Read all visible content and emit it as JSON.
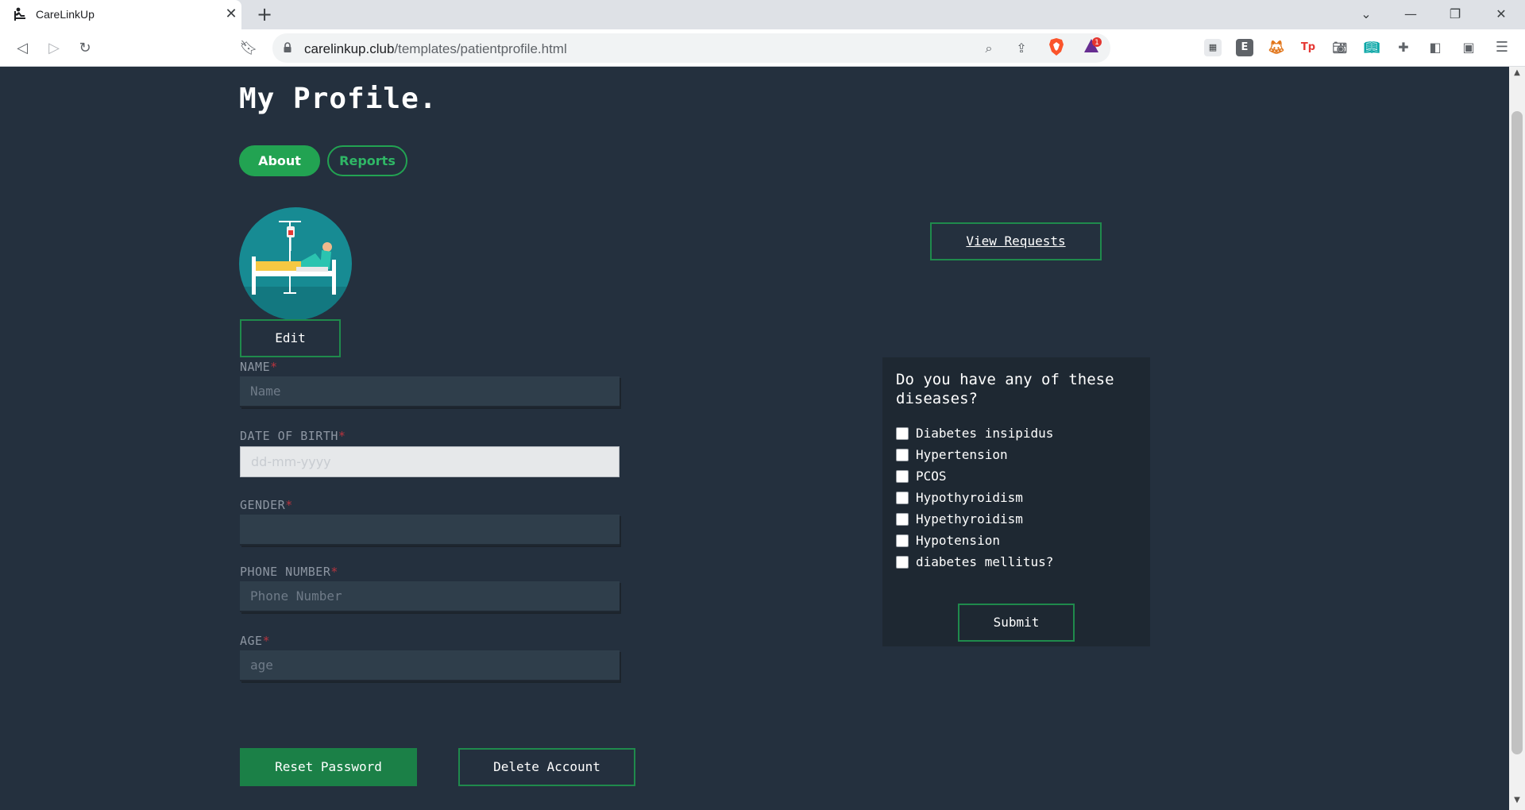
{
  "browser": {
    "tab_title": "CareLinkUp",
    "tab_close": "✕",
    "new_tab": "+",
    "url_host": "carelinkup.club",
    "url_path": "/templates/patientprofile.html",
    "rewards_badge": "1",
    "icons": [
      "back-icon",
      "forward-icon",
      "reload-icon",
      "bookmark-icon",
      "lock-icon",
      "zoom-icon",
      "share-icon",
      "brave-shields-icon",
      "brave-rewards-icon",
      "extensions-icon",
      "sidebar-icon",
      "wallet-icon",
      "menu-icon"
    ],
    "extension_glyphs": {
      "e": "E",
      "tp": "Tp"
    }
  },
  "page": {
    "title": "My Profile.",
    "tabs": {
      "about": "About",
      "reports": "Reports"
    },
    "edit_label": "Edit",
    "view_requests_label": "View Requests",
    "accent_color": "#22a352",
    "background_color": "#24303e"
  },
  "form": {
    "required_mark": "*",
    "name": {
      "label": "NAME",
      "placeholder": "Name"
    },
    "dob": {
      "label": "DATE OF BIRTH",
      "placeholder": "dd-mm-yyyy"
    },
    "gender": {
      "label": "GENDER",
      "placeholder": ""
    },
    "phone": {
      "label": "PHONE NUMBER",
      "placeholder": "Phone Number"
    },
    "age": {
      "label": "AGE",
      "placeholder": "age"
    }
  },
  "diseases": {
    "question": "Do you have any of these diseases?",
    "options": [
      "Diabetes insipidus",
      "Hypertension",
      "PCOS",
      "Hypothyroidism",
      "Hypethyroidism",
      "Hypotension",
      "diabetes mellitus?"
    ],
    "submit_label": "Submit"
  },
  "actions": {
    "reset_password": "Reset Password",
    "delete_account": "Delete Account"
  }
}
